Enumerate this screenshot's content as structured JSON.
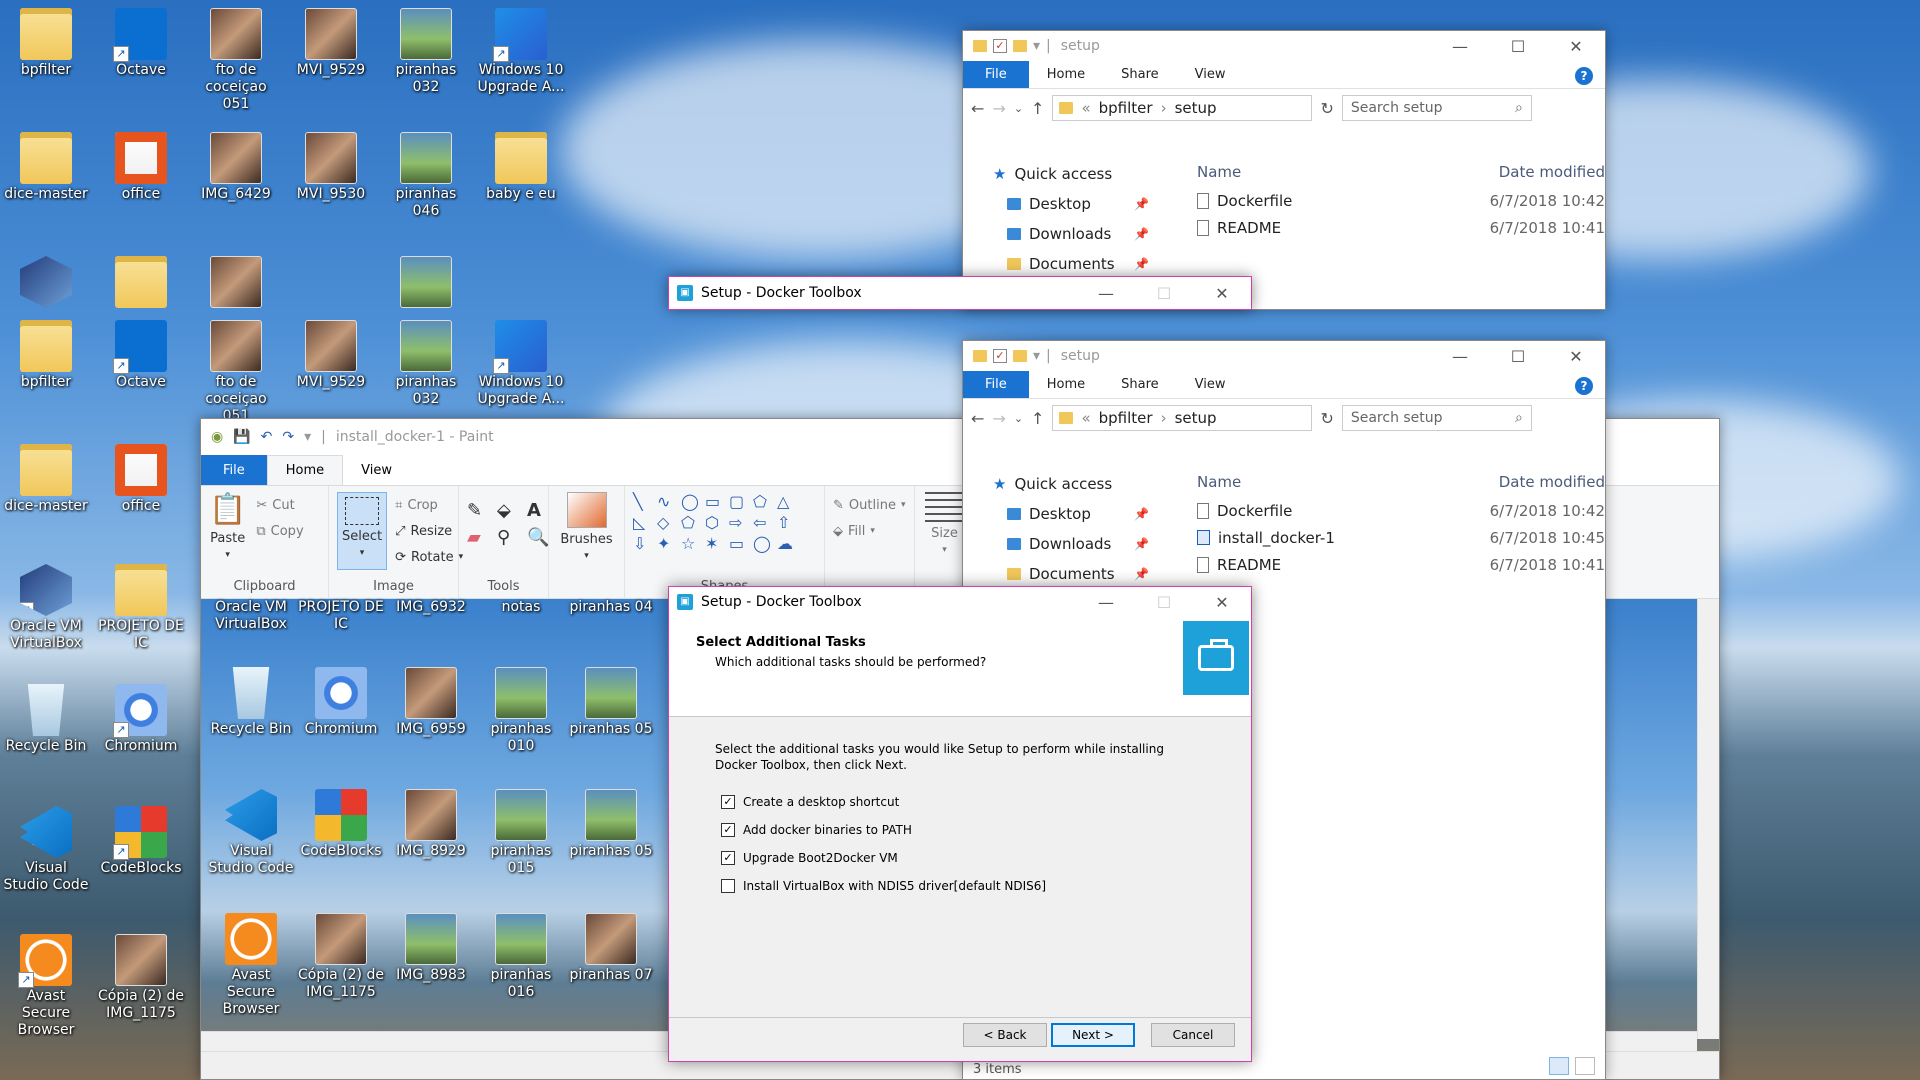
{
  "desktop": {
    "top_icons_row1": [
      "bpfilter",
      "Octave",
      "fto de coceiçao 051",
      "MVI_9529",
      "piranhas 032",
      "Windows 10 Upgrade A..."
    ],
    "top_icons_row2": [
      "dice-master",
      "office",
      "IMG_6429",
      "MVI_9530",
      "piranhas 046",
      "baby e eu"
    ],
    "left_column": [
      "bpfilter",
      "dice-master",
      "Oracle VM VirtualBox",
      "Recycle Bin",
      "Visual Studio Code",
      "Avast Secure Browser"
    ],
    "second_column": [
      "Octave",
      "office",
      "PROJETO DE IC",
      "Chromium",
      "CodeBlocks",
      "Cópia (2) de IMG_1175"
    ],
    "row3_top": [
      "fto de coceiçao 051",
      "MVI_9529",
      "piranhas 032",
      "Windows 10 Upgrade A..."
    ]
  },
  "explorer_top": {
    "title": "setup",
    "tabs": [
      "File",
      "Home",
      "Share",
      "View"
    ],
    "breadcrumb": [
      "«",
      "bpfilter",
      "setup"
    ],
    "search_placeholder": "Search setup",
    "nav": [
      "Quick access",
      "Desktop",
      "Downloads",
      "Documents"
    ],
    "col_name": "Name",
    "col_date": "Date modified",
    "files": [
      {
        "name": "Dockerfile",
        "date": "6/7/2018 10:42"
      },
      {
        "name": "README",
        "date": "6/7/2018 10:41"
      }
    ]
  },
  "explorer_mid": {
    "title": "setup",
    "tabs": [
      "File",
      "Home",
      "Share",
      "View"
    ],
    "breadcrumb": [
      "«",
      "bpfilter",
      "setup"
    ],
    "search_placeholder": "Search setup",
    "nav": [
      "Quick access",
      "Desktop",
      "Downloads",
      "Documents"
    ],
    "col_name": "Name",
    "col_date": "Date modified",
    "files": [
      {
        "name": "Dockerfile",
        "date": "6/7/2018 10:42"
      },
      {
        "name": "install_docker-1",
        "date": "6/7/2018 10:45"
      },
      {
        "name": "README",
        "date": "6/7/2018 10:41"
      }
    ]
  },
  "paint": {
    "title": "install_docker-1 - Paint",
    "tabs": [
      "File",
      "Home",
      "View"
    ],
    "clipboard": {
      "paste": "Paste",
      "cut": "Cut",
      "copy": "Copy",
      "label": "Clipboard"
    },
    "image": {
      "select": "Select",
      "crop": "Crop",
      "resize": "Resize",
      "rotate": "Rotate",
      "label": "Image"
    },
    "tools_label": "Tools",
    "brushes": "Brushes",
    "shapes": {
      "outline": "Outline",
      "fill": "Fill",
      "label": "Shapes"
    },
    "size": "Size",
    "status_items": "3 items",
    "canvas_icons": [
      "Oracle VM VirtualBox",
      "PROJETO DE IC",
      "IMG_6932",
      "notas",
      "piranhas 04",
      "Recycle Bin",
      "Chromium",
      "IMG_6959",
      "piranhas 010",
      "piranhas 05",
      "Visual Studio Code",
      "CodeBlocks",
      "IMG_8929",
      "piranhas 015",
      "piranhas 05",
      "Avast Secure Browser",
      "Cópia (2) de IMG_1175",
      "IMG_8983",
      "piranhas 016",
      "piranhas 07"
    ]
  },
  "dialog_small": {
    "title": "Setup - Docker Toolbox"
  },
  "dialog": {
    "title": "Setup - Docker Toolbox",
    "heading": "Select Additional Tasks",
    "subheading": "Which additional tasks should be performed?",
    "intro": "Select the additional tasks you would like Setup to perform while installing Docker Toolbox, then click Next.",
    "tasks": [
      {
        "label": "Create a desktop shortcut",
        "checked": true
      },
      {
        "label": "Add docker binaries to PATH",
        "checked": true
      },
      {
        "label": "Upgrade Boot2Docker VM",
        "checked": true
      },
      {
        "label": "Install VirtualBox with NDIS5 driver[default NDIS6]",
        "checked": false
      }
    ],
    "back": "< Back",
    "next": "Next >",
    "cancel": "Cancel"
  }
}
